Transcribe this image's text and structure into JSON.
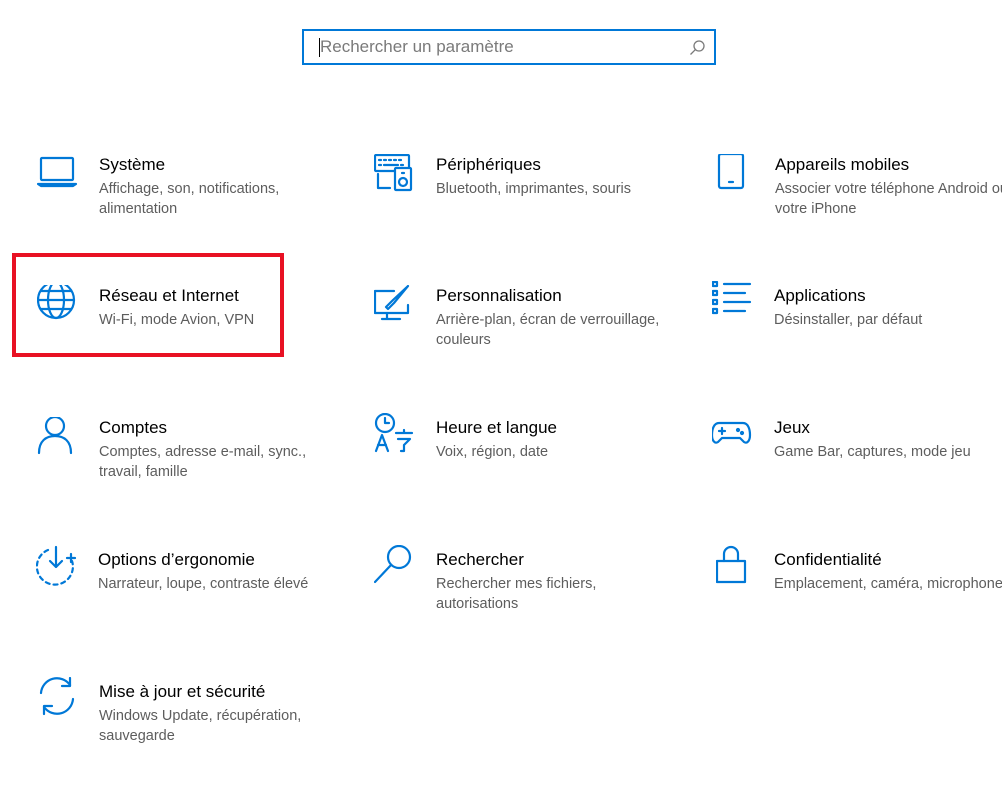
{
  "search": {
    "placeholder": "Rechercher un paramètre",
    "icon": "search-icon"
  },
  "tiles": [
    {
      "id": "systeme",
      "title": "Système",
      "desc": "Affichage, son, notifications, alimentation",
      "icon": "laptop-icon"
    },
    {
      "id": "peripheriques",
      "title": "Périphériques",
      "desc": "Bluetooth, imprimantes, souris",
      "icon": "devices-icon"
    },
    {
      "id": "appareils-mobiles",
      "title": "Appareils mobiles",
      "desc": "Associer votre téléphone Android ou votre iPhone",
      "icon": "phone-icon"
    },
    {
      "id": "reseau",
      "title": "Réseau et Internet",
      "desc": "Wi-Fi, mode Avion, VPN",
      "icon": "globe-icon"
    },
    {
      "id": "personnalisation",
      "title": "Personnalisation",
      "desc": "Arrière-plan, écran de verrouillage, couleurs",
      "icon": "paint-icon"
    },
    {
      "id": "applications",
      "title": "Applications",
      "desc": "Désinstaller, par défaut",
      "icon": "apps-list-icon"
    },
    {
      "id": "comptes",
      "title": "Comptes",
      "desc": "Comptes, adresse e-mail, sync., travail, famille",
      "icon": "person-icon"
    },
    {
      "id": "heure-langue",
      "title": "Heure et langue",
      "desc": "Voix, région, date",
      "icon": "time-language-icon"
    },
    {
      "id": "jeux",
      "title": "Jeux",
      "desc": "Game Bar, captures, mode jeu",
      "icon": "gamepad-icon"
    },
    {
      "id": "ergonomie",
      "title": "Options d’ergonomie",
      "desc": "Narrateur, loupe, contraste élevé",
      "icon": "ease-of-access-icon"
    },
    {
      "id": "rechercher",
      "title": "Rechercher",
      "desc": "Rechercher mes fichiers, autorisations",
      "icon": "magnifier-icon"
    },
    {
      "id": "confidentialite",
      "title": "Confidentialité",
      "desc": "Emplacement, caméra, microphone",
      "icon": "lock-icon"
    },
    {
      "id": "mise-a-jour",
      "title": "Mise à jour et sécurité",
      "desc": "Windows Update, récupération, sauvegarde",
      "icon": "update-icon"
    }
  ],
  "colors": {
    "accent": "#0078d7",
    "highlight": "#e81123",
    "desc_text": "#5d5d5d"
  }
}
